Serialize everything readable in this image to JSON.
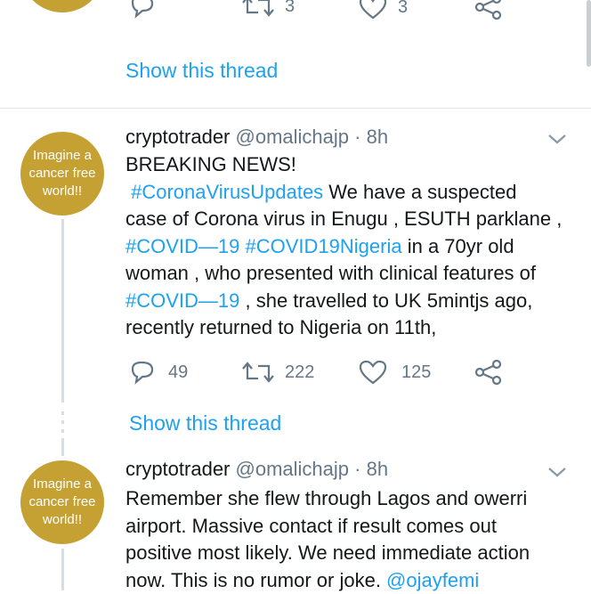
{
  "prev_tweet": {
    "retweet_count": "3",
    "like_count": "3",
    "show_thread": "Show this thread"
  },
  "tweet1": {
    "avatar_text": "Imagine a\ncancer free\nworld!!",
    "name": "cryptotrader",
    "handle": "@omalichajp",
    "sep": "·",
    "time": "8h",
    "line1": "BREAKING NEWS!",
    "tag_corona": "#CoronaVirusUpdates",
    "line2_rest": " We have a suspected",
    "line3": "case of Corona virus in Enugu , ESUTH parklane ,",
    "tag_covid": "#COVID—19",
    "tag_covid_ng": "#COVID19Nigeria",
    "line4_rest": " in a 70yr old",
    "line5": "woman , who presented with clinical features of",
    "tag_covid_b": "#COVID—19",
    "line6_rest": " , she travelled to UK 5mintjs ago,",
    "line7": "recently returned to Nigeria on 11th,",
    "reply_count": "49",
    "retweet_count": "222",
    "like_count": "125",
    "show_thread": "Show this thread"
  },
  "tweet2": {
    "avatar_text": "Imagine a\ncancer free\nworld!!",
    "name": "cryptotrader",
    "handle": "@omalichajp",
    "sep": "·",
    "time": "8h",
    "line1": "Remember she flew through Lagos and owerri",
    "line2": "airport. Massive contact if result comes out",
    "line3": "positive most likely. We need immediate action",
    "line4": "now. This is no rumor or joke. ",
    "mention": "@ojayfemi"
  },
  "colors": {
    "accent": "#1da1f2",
    "muted": "#657786",
    "avatar_bg": "#c5a032"
  }
}
